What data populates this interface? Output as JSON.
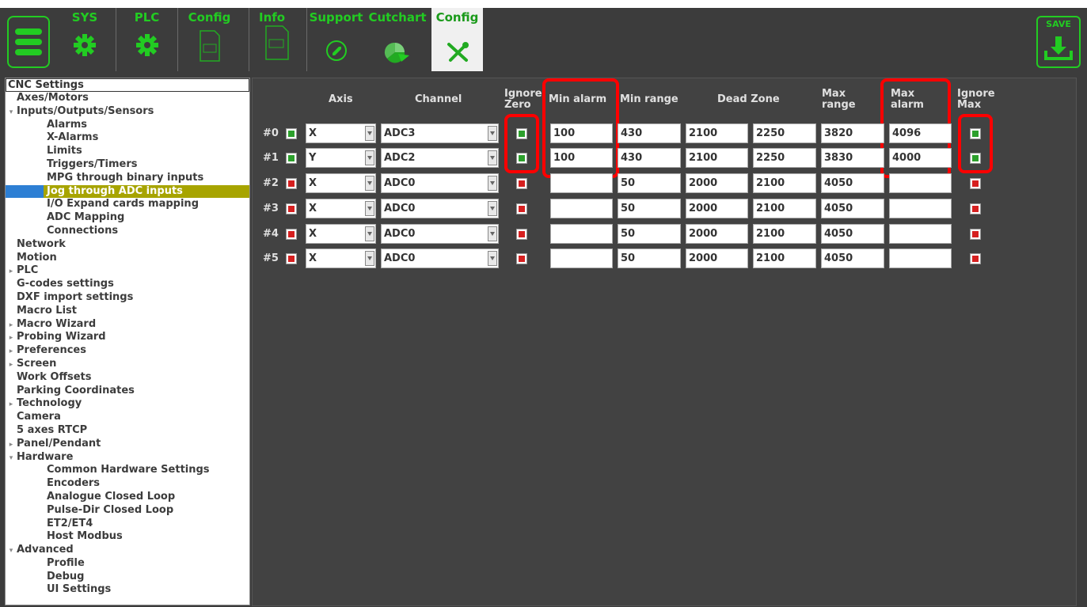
{
  "tabs": [
    {
      "label": "SYS",
      "icon": "gear-icon"
    },
    {
      "label": "PLC",
      "icon": "gear-icon"
    },
    {
      "label": "Config",
      "icon": "document-icon"
    },
    {
      "label": "Info",
      "icon": "document-icon"
    },
    {
      "label": "Support",
      "icon": "phone-icon"
    },
    {
      "label": "Cutchart",
      "icon": "pie-chart-icon"
    },
    {
      "label": "Config",
      "icon": "tools-icon"
    }
  ],
  "save_label": "SAVE",
  "tree": [
    "CNC Settings",
    "Axes/Motors",
    "Inputs/Outputs/Sensors",
    "Alarms",
    "X-Alarms",
    "Limits",
    "Triggers/Timers",
    "MPG through binary inputs",
    "Jog through ADC inputs",
    "I/O Expand cards mapping",
    "ADC Mapping",
    "Connections",
    "Network",
    "Motion",
    "PLC",
    "G-codes settings",
    "DXF import settings",
    "Macro List",
    "Macro Wizard",
    "Probing Wizard",
    "Preferences",
    "Screen",
    "Work Offsets",
    "Parking Coordinates",
    "Technology",
    "Camera",
    "5 axes RTCP",
    "Panel/Pendant",
    "Hardware",
    "Common Hardware Settings",
    "Encoders",
    "Analogue Closed Loop",
    "Pulse-Dir Closed Loop",
    "ET2/ET4",
    "Host Modbus",
    "Advanced",
    "Profile",
    "Debug",
    "UI Settings"
  ],
  "headers": {
    "axis": "Axis",
    "channel": "Channel",
    "ignore_zero_1": "Ignore",
    "ignore_zero_2": "Zero",
    "min_alarm": "Min alarm",
    "min_range": "Min range",
    "dead_zone": "Dead Zone",
    "max_range_1": "Max",
    "max_range_2": "range",
    "max_alarm_1": "Max",
    "max_alarm_2": "alarm",
    "ignore_max_1": "Ignore",
    "ignore_max_2": "Max"
  },
  "rows": [
    {
      "id": "#0",
      "enabled": true,
      "axis": "X",
      "channel": "ADC3",
      "ignore_zero": true,
      "min_alarm": "100",
      "min_range": "430",
      "dz1": "2100",
      "dz2": "2250",
      "max_range": "3820",
      "max_alarm": "4096",
      "ignore_max": true
    },
    {
      "id": "#1",
      "enabled": true,
      "axis": "Y",
      "channel": "ADC2",
      "ignore_zero": true,
      "min_alarm": "100",
      "min_range": "430",
      "dz1": "2100",
      "dz2": "2250",
      "max_range": "3830",
      "max_alarm": "4000",
      "ignore_max": true
    },
    {
      "id": "#2",
      "enabled": false,
      "axis": "X",
      "channel": "ADC0",
      "ignore_zero": false,
      "min_alarm": "",
      "min_range": "50",
      "dz1": "2000",
      "dz2": "2100",
      "max_range": "4050",
      "max_alarm": "",
      "ignore_max": false
    },
    {
      "id": "#3",
      "enabled": false,
      "axis": "X",
      "channel": "ADC0",
      "ignore_zero": false,
      "min_alarm": "",
      "min_range": "50",
      "dz1": "2000",
      "dz2": "2100",
      "max_range": "4050",
      "max_alarm": "",
      "ignore_max": false
    },
    {
      "id": "#4",
      "enabled": false,
      "axis": "X",
      "channel": "ADC0",
      "ignore_zero": false,
      "min_alarm": "",
      "min_range": "50",
      "dz1": "2000",
      "dz2": "2100",
      "max_range": "4050",
      "max_alarm": "",
      "ignore_max": false
    },
    {
      "id": "#5",
      "enabled": false,
      "axis": "X",
      "channel": "ADC0",
      "ignore_zero": false,
      "min_alarm": "",
      "min_range": "50",
      "dz1": "2000",
      "dz2": "2100",
      "max_range": "4050",
      "max_alarm": "",
      "ignore_max": false
    }
  ]
}
